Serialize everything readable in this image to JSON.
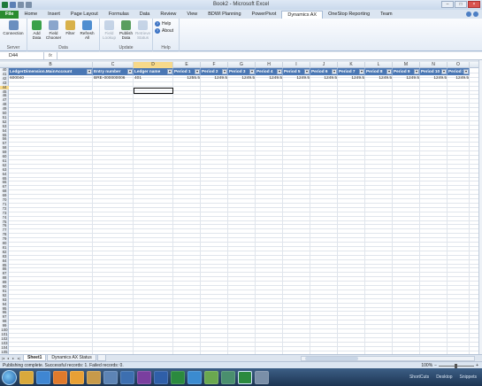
{
  "window": {
    "title": "Book2 - Microsoft Excel"
  },
  "ribbon_tabs": [
    "File",
    "Home",
    "Insert",
    "Page Layout",
    "Formulas",
    "Data",
    "Review",
    "View",
    "BDWI Planning",
    "PowerPivot",
    "Dynamics AX",
    "OneStop Reporting",
    "Team"
  ],
  "active_tab": "Dynamics AX",
  "ribbon": {
    "groups": [
      {
        "label": "Server",
        "buttons": [
          "Connection"
        ]
      },
      {
        "label": "Data",
        "buttons": [
          "Add Data",
          "Field Chooser",
          "Filter",
          "Refresh All"
        ]
      },
      {
        "label": "Update",
        "buttons": [
          "Field Lookup",
          "Publish Data",
          "Retrieve Status"
        ]
      },
      {
        "label": "Help",
        "buttons": [
          "Help",
          "About"
        ]
      }
    ]
  },
  "formula_bar": {
    "name_box": "D44",
    "fx": "fx",
    "value": ""
  },
  "columns": [
    "B",
    "C",
    "D",
    "E",
    "F",
    "G",
    "H",
    "I",
    "J",
    "K",
    "L",
    "M",
    "N",
    "O"
  ],
  "selected_column": "D",
  "rows": [
    "40",
    "41",
    "42",
    "43",
    "44",
    "45",
    "46",
    "47",
    "48",
    "49",
    "50",
    "51",
    "52",
    "53",
    "54",
    "55",
    "56",
    "57",
    "58",
    "59",
    "60",
    "61",
    "62",
    "63",
    "64",
    "65",
    "66",
    "67",
    "68",
    "69",
    "70",
    "71",
    "72",
    "73",
    "74",
    "75",
    "76",
    "77",
    "78",
    "79",
    "80",
    "81",
    "82",
    "83",
    "84",
    "85",
    "86",
    "87",
    "88",
    "89",
    "90",
    "91",
    "92",
    "93",
    "94",
    "95",
    "96",
    "97",
    "98",
    "99",
    "100",
    "101",
    "102",
    "103",
    "104",
    "105"
  ],
  "selected_row": "44",
  "table": {
    "headers": [
      "LedgerDimension.MainAccount",
      "Entry number",
      "Ledger name",
      "Period 1",
      "Period 2",
      "Period 3",
      "Period 4",
      "Period 5",
      "Period 6",
      "Period 7",
      "Period 8",
      "Period 9",
      "Period 10",
      "Period 1"
    ],
    "row": [
      "600040",
      "BRE-000000006",
      "401",
      "1255.5",
      "1249.5",
      "1249.5",
      "1249.5",
      "1249.5",
      "1249.5",
      "1249.5",
      "1249.5",
      "1249.5",
      "1249.5",
      "1249.5"
    ]
  },
  "sheets": [
    "Sheet1",
    "Dynamics AX Status"
  ],
  "active_sheet": "Sheet1",
  "status": {
    "message": "Publishing complete. Successful records: 1. Failed records: 0.",
    "zoom": "100%"
  },
  "taskbar": {
    "tray": [
      "ShortCuts",
      "Desktop",
      "Snippets"
    ]
  },
  "colors": {
    "file_tab": "#2a8b2f",
    "table_header": "#4a77b4",
    "selection_highlight": "#f7d98a",
    "taskbar": "#1c3452"
  }
}
